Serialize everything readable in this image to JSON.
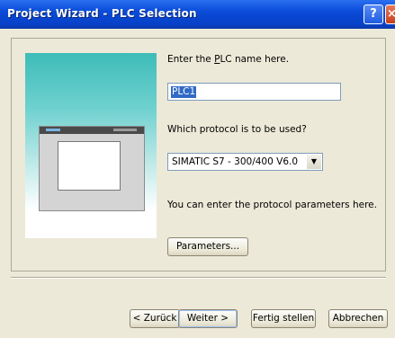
{
  "window": {
    "title": "Project Wizard - PLC Selection"
  },
  "titlebar": {
    "help_glyph": "?",
    "close_glyph": "×"
  },
  "form": {
    "plc_name_label_pre": "Enter the ",
    "plc_name_label_acc": "P",
    "plc_name_label_post": "LC name here.",
    "plc_name_value": "PLC1",
    "protocol_label": "Which protocol is to be used?",
    "protocol_value": "SIMATIC S7 - 300/400 V6.0",
    "params_hint": "You can enter the protocol parameters here.",
    "params_button": "Parameters..."
  },
  "footer": {
    "back": "< Zurück",
    "next": "Weiter >",
    "finish": "Fertig stellen",
    "cancel": "Abbrechen"
  },
  "colors": {
    "titlebar": "#0a4bd8",
    "dialog_bg": "#ece9d8",
    "accent": "#316ac5"
  }
}
